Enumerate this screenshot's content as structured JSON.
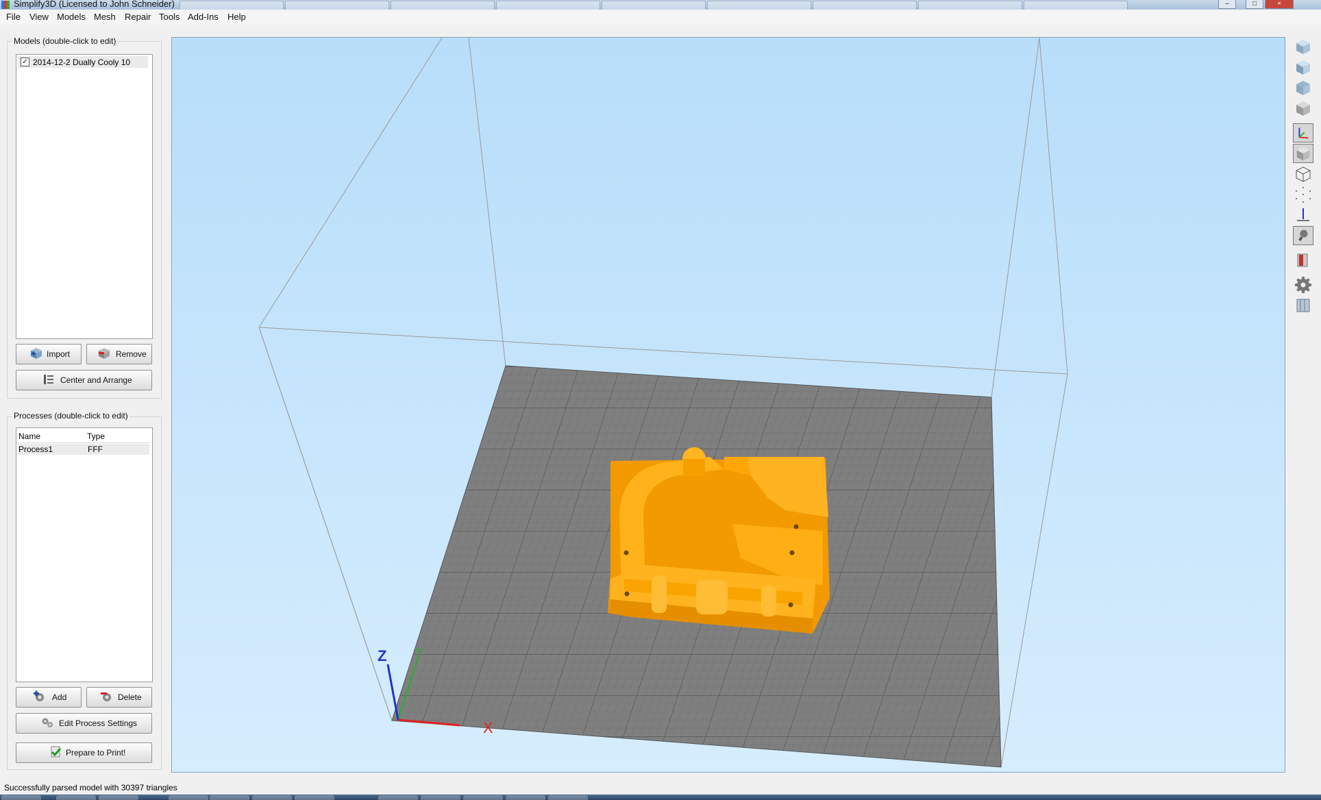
{
  "window": {
    "title": "Simplify3D (Licensed to John Schneider)"
  },
  "menu": [
    "File",
    "View",
    "Models",
    "Mesh",
    "Repair",
    "Tools",
    "Add-Ins",
    "Help"
  ],
  "models_panel": {
    "title": "Models (double-click to edit)",
    "items": [
      {
        "name": "2014-12-2 Dually Cooly 10",
        "checked": true
      }
    ],
    "import_label": "Import",
    "remove_label": "Remove",
    "center_label": "Center and Arrange"
  },
  "processes_panel": {
    "title": "Processes (double-click to edit)",
    "columns": [
      "Name",
      "Type"
    ],
    "rows": [
      {
        "name": "Process1",
        "type": "FFF"
      }
    ],
    "add_label": "Add",
    "delete_label": "Delete",
    "edit_label": "Edit Process Settings",
    "prepare_label": "Prepare to Print!"
  },
  "viewport": {
    "axis_labels": {
      "x": "X",
      "y": "Y",
      "z": "Z"
    },
    "colors": {
      "bed": "#7f7f7f",
      "model": "#ffad0a",
      "sky": "#c2e3fb",
      "x_axis": "#e02020",
      "y_axis": "#22b522",
      "z_axis": "#2233cc"
    }
  },
  "toolbar_icons": [
    "view-isometric-icon",
    "view-front-icon",
    "view-top-icon",
    "view-side-icon",
    "axes-toggle-icon",
    "solid-view-icon",
    "wireframe-view-icon",
    "point-view-icon",
    "normals-view-icon",
    "lighting-icon",
    "cross-section-icon",
    "settings-gear-icon",
    "machine-icon"
  ],
  "status": {
    "message": "Successfully parsed model with 30397 triangles"
  }
}
